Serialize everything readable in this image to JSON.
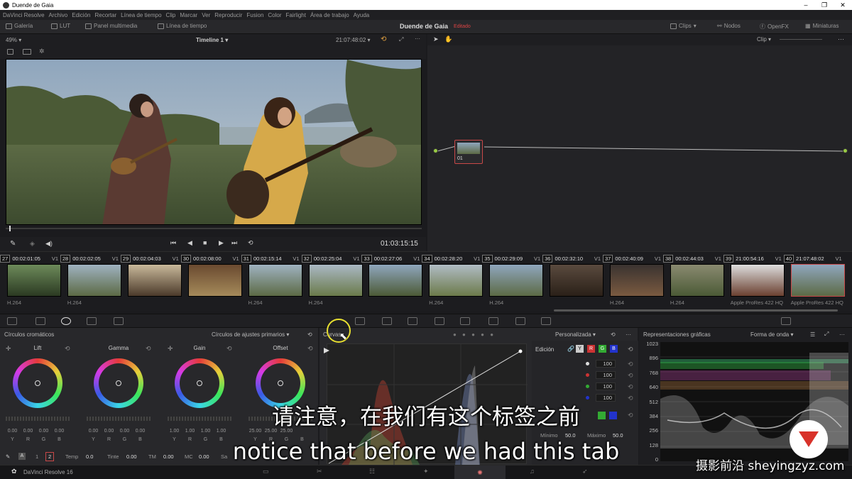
{
  "window": {
    "title": "Duende de Gaia",
    "controls": [
      "–",
      "❐",
      "✕"
    ]
  },
  "menu": [
    "DaVinci Resolve",
    "Archivo",
    "Edición",
    "Recortar",
    "Línea de tiempo",
    "Clip",
    "Marcar",
    "Ver",
    "Reproducir",
    "Fusion",
    "Color",
    "Fairlight",
    "Área de trabajo",
    "Ayuda"
  ],
  "toolbar": {
    "galeria": "Galería",
    "lut": "LUT",
    "panel_multimedia": "Panel multimedia",
    "linea_tiempo": "Línea de tiempo",
    "project_name": "Duende de Gaia",
    "project_status": "Editado",
    "clips": "Clips",
    "nodos": "Nodos",
    "openfx": "OpenFX",
    "miniaturas": "Miniaturas"
  },
  "viewer": {
    "zoom": "49%",
    "timeline": "Timeline 1",
    "source_timecode": "21:07:48:02",
    "timecode": "01:03:15:15",
    "clip_mode": "Clip"
  },
  "nodes": {
    "node_label": "01"
  },
  "clips": [
    {
      "num": "27",
      "tc": "00:02:01:05",
      "track": "V1",
      "codec": "H.264"
    },
    {
      "num": "28",
      "tc": "00:02:02:05",
      "track": "V1",
      "codec": "H.264"
    },
    {
      "num": "29",
      "tc": "00:02:04:03",
      "track": "V1",
      "codec": ""
    },
    {
      "num": "30",
      "tc": "00:02:08:00",
      "track": "V1",
      "codec": ""
    },
    {
      "num": "31",
      "tc": "00:02:15:14",
      "track": "V1",
      "codec": "H.264"
    },
    {
      "num": "32",
      "tc": "00:02:25:04",
      "track": "V1",
      "codec": "H.264"
    },
    {
      "num": "33",
      "tc": "00:02:27:06",
      "track": "V1",
      "codec": ""
    },
    {
      "num": "34",
      "tc": "00:02:28:20",
      "track": "V1",
      "codec": "H.264"
    },
    {
      "num": "35",
      "tc": "00:02:29:09",
      "track": "V1",
      "codec": "H.264"
    },
    {
      "num": "36",
      "tc": "00:02:32:10",
      "track": "V1",
      "codec": ""
    },
    {
      "num": "37",
      "tc": "00:02:40:09",
      "track": "V1",
      "codec": "H.264"
    },
    {
      "num": "38",
      "tc": "00:02:44:03",
      "track": "V1",
      "codec": "H.264"
    },
    {
      "num": "39",
      "tc": "21:00:54:16",
      "track": "V1",
      "codec": "Apple ProRes 422 HQ"
    },
    {
      "num": "40",
      "tc": "21:07:48:02",
      "track": "V1",
      "codec": "Apple ProRes 422 HQ"
    }
  ],
  "color_wheels": {
    "title": "Círculos cromáticos",
    "mode": "Círculos de ajustes primarios",
    "wheels": [
      {
        "name": "Lift",
        "values": [
          "0.00",
          "0.00",
          "0.00",
          "0.00"
        ]
      },
      {
        "name": "Gamma",
        "values": [
          "0.00",
          "0.00",
          "0.00",
          "0.00"
        ]
      },
      {
        "name": "Gain",
        "values": [
          "1.00",
          "1.00",
          "1.00",
          "1.00"
        ]
      },
      {
        "name": "Offset",
        "values": [
          "25.00",
          "25.00",
          "25.00",
          ""
        ]
      }
    ],
    "channels": [
      "Y",
      "R",
      "G",
      "B"
    ],
    "footer": {
      "page1": "1",
      "page2": "2",
      "temp_label": "Temp",
      "temp": "0.0",
      "tint_label": "Tinte",
      "tint": "0.00",
      "tm_label": "TM",
      "tm": "0.00",
      "mc_label": "MC",
      "mc": "0.00",
      "sa_label": "Sa"
    }
  },
  "curves": {
    "title": "Curvas",
    "mode": "Personalizada",
    "edicion": "Edición",
    "channels": [
      "Y",
      "R",
      "G",
      "B"
    ],
    "intensity": [
      "100",
      "100",
      "100",
      "100"
    ],
    "min_label": "Mínimo",
    "min": "50.0",
    "max_label": "Máximo",
    "max": "50.0"
  },
  "scopes": {
    "title": "Representaciones gráficas",
    "mode": "Forma de onda",
    "ticks": [
      "1023",
      "896",
      "768",
      "640",
      "512",
      "384",
      "256",
      "128",
      "0"
    ]
  },
  "bottom": {
    "app": "DaVinci Resolve 16"
  },
  "subtitles": {
    "zh": "请注意，在我们有这个标签之前",
    "en": "notice that before we had this tab"
  },
  "watermark": "摄影前沿 sheyingzyz.com"
}
